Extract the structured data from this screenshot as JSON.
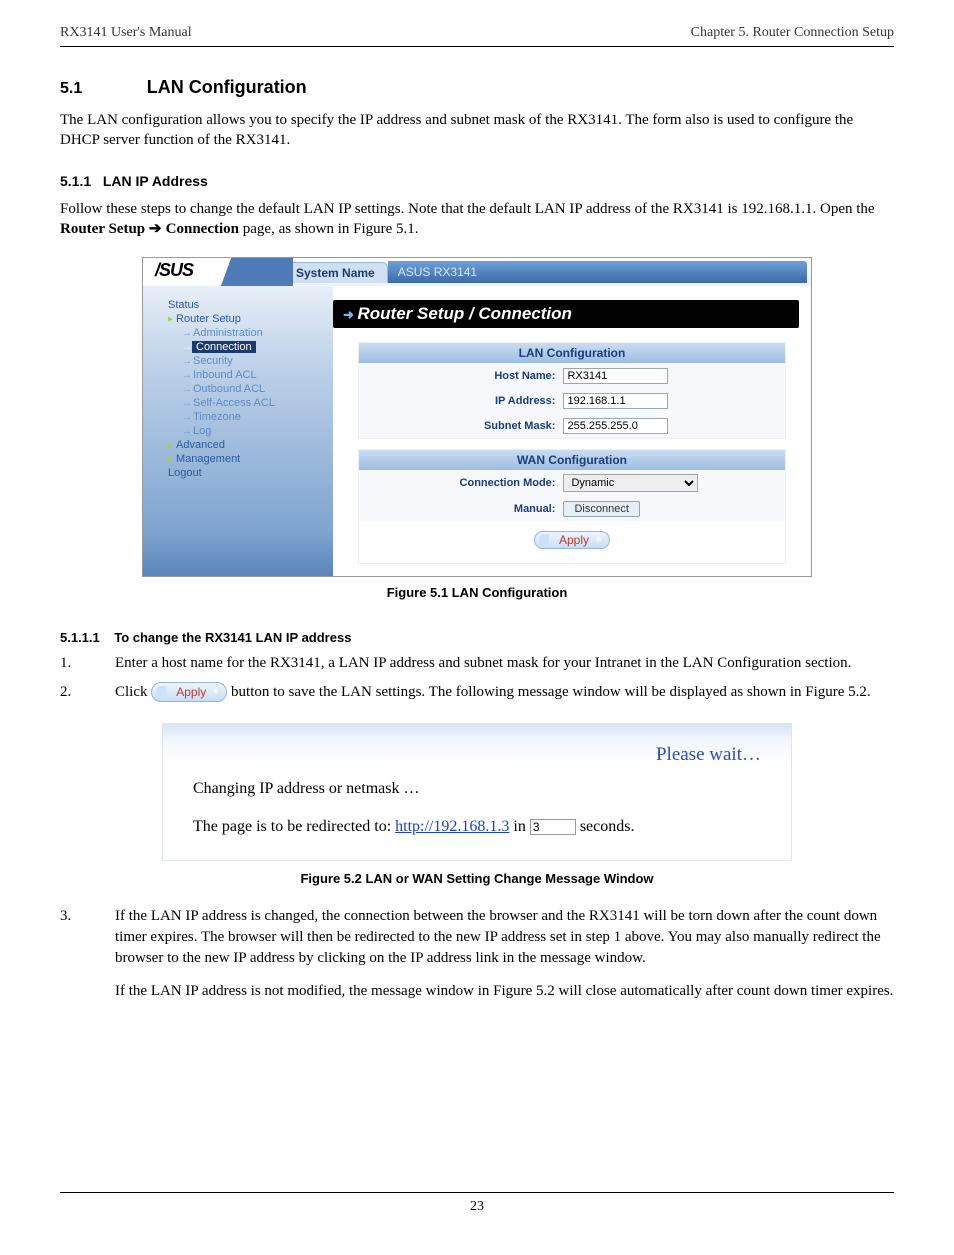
{
  "header": {
    "left": "RX3141 User's Manual",
    "right": "Chapter 5. Router Connection Setup"
  },
  "section": {
    "num": "5.1",
    "title": "LAN Configuration"
  },
  "intro_p1": "The LAN configuration allows you to specify the IP address and subnet mask of the RX3141. The form also is used to configure the DHCP server function of the RX3141.",
  "subsection": {
    "num": "5.1.1",
    "title": "LAN IP Address"
  },
  "lanip_p1_prefix": "Follow these steps to change the default LAN IP settings. Note that the default LAN IP address of the RX3141 is 192.168.1.1. Open the ",
  "lanip_p1_bold1": "Router Setup ",
  "lanip_p1_arrow": "➔ ",
  "lanip_p1_bold2": "Connection",
  "lanip_p1_suffix": " page, as shown in Figure 5.1.",
  "screenshot": {
    "system_name_label": "System Name",
    "system_name_value": "ASUS RX3141",
    "logo": "/SUS",
    "nav": {
      "status": "Status",
      "router_setup": "Router Setup",
      "administration": "Administration",
      "connection": "Connection",
      "security": "Security",
      "inbound": "Inbound ACL",
      "outbound": "Outbound ACL",
      "selfaccess": "Self-Access ACL",
      "timezone": "Timezone",
      "log": "Log",
      "advanced": "Advanced",
      "management": "Management",
      "logout": "Logout"
    },
    "page_title": "Router Setup / Connection",
    "lan": {
      "header": "LAN Configuration",
      "host_label": "Host Name:",
      "host_value": "RX3141",
      "ip_label": "IP Address:",
      "ip_value": "192.168.1.1",
      "mask_label": "Subnet Mask:",
      "mask_value": "255.255.255.0"
    },
    "wan": {
      "header": "WAN Configuration",
      "mode_label": "Connection Mode:",
      "mode_value": "Dynamic",
      "manual_label": "Manual:",
      "disconnect": "Disconnect"
    },
    "apply": "Apply"
  },
  "fig_caption": "Figure 5.1 LAN Configuration",
  "subsub": {
    "num": "5.1.1.1",
    "title": "To change the RX3141 LAN IP address"
  },
  "step1": {
    "num": "1.",
    "text": "Enter a host name for the RX3141, a LAN IP address and subnet mask for your Intranet in the LAN Configuration section."
  },
  "step2": {
    "num": "2.",
    "prefix": "Click ",
    "suffix": " button to save the LAN settings. The following message window will be displayed as shown in Figure 5.2."
  },
  "apply_inline": "Apply",
  "msgbox": {
    "wait": "Please wait…",
    "changing": "Changing IP address or netmask …",
    "redirect_prefix": "The page is to be redirected to: ",
    "url": "http://192.168.1.3",
    "mid": " in ",
    "secs_val": "3",
    "suffix": " seconds."
  },
  "fig2_caption": "Figure 5.2 LAN or WAN Setting Change Message Window",
  "step3": {
    "num": "3.",
    "p1": "If the LAN IP address is changed, the connection between the browser and the RX3141 will be torn down after the count down timer expires. The browser will then be redirected to the new IP address set in step 1 above. You may also manually redirect the browser to the new IP address by clicking on the IP address link in the message window.",
    "p2": "If the LAN IP address is not modified, the message window in Figure 5.2 will close automatically after count down timer expires."
  },
  "page_num": "23"
}
